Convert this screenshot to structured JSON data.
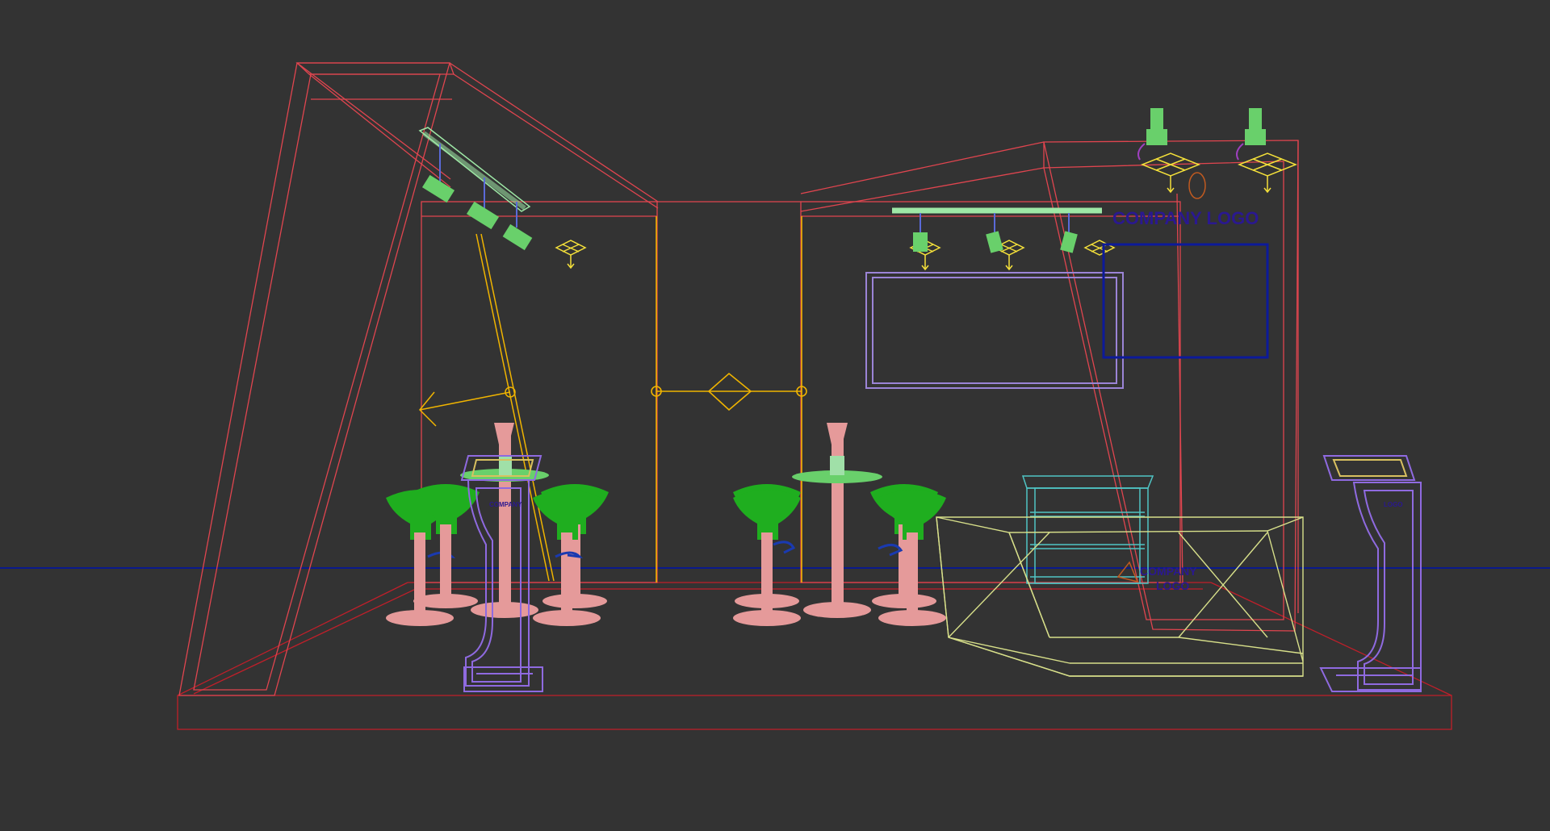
{
  "viewport": {
    "background": "#333333",
    "horizon_color": "#0a1a8c"
  },
  "colors": {
    "booth_frame": "#e0454f",
    "floor_frame": "#c01f2a",
    "door_frame": "#f0b400",
    "light_rail": "#9ee8a6",
    "spotlight_body": "#69d06b",
    "spotlight_target": "#f4e03a",
    "screen_frame": "#9b84d6",
    "table": "#e59a9a",
    "stool_seat": "#1fae1f",
    "kiosk": "#8f6ae0",
    "counter": "#d8e08a",
    "display_case": "#4fc4c4",
    "logo_panel": "#0c1a9a",
    "logo_text": "#2a1890"
  },
  "logos": {
    "wall_logo": "COMPANY LOGO",
    "counter_logo_line1": "COMPANY",
    "counter_logo_line2": "LOGO",
    "kiosk_logo_line1": "COMPANY",
    "kiosk_logo_line2": "LOGO"
  },
  "scene_objects": [
    "booth-structure",
    "floor-platform",
    "door-frame",
    "light-rails",
    "spotlights",
    "wall-screen",
    "logo-panel",
    "bar-tables",
    "bar-stools",
    "kiosks",
    "reception-counter",
    "display-case",
    "light-gizmo"
  ]
}
